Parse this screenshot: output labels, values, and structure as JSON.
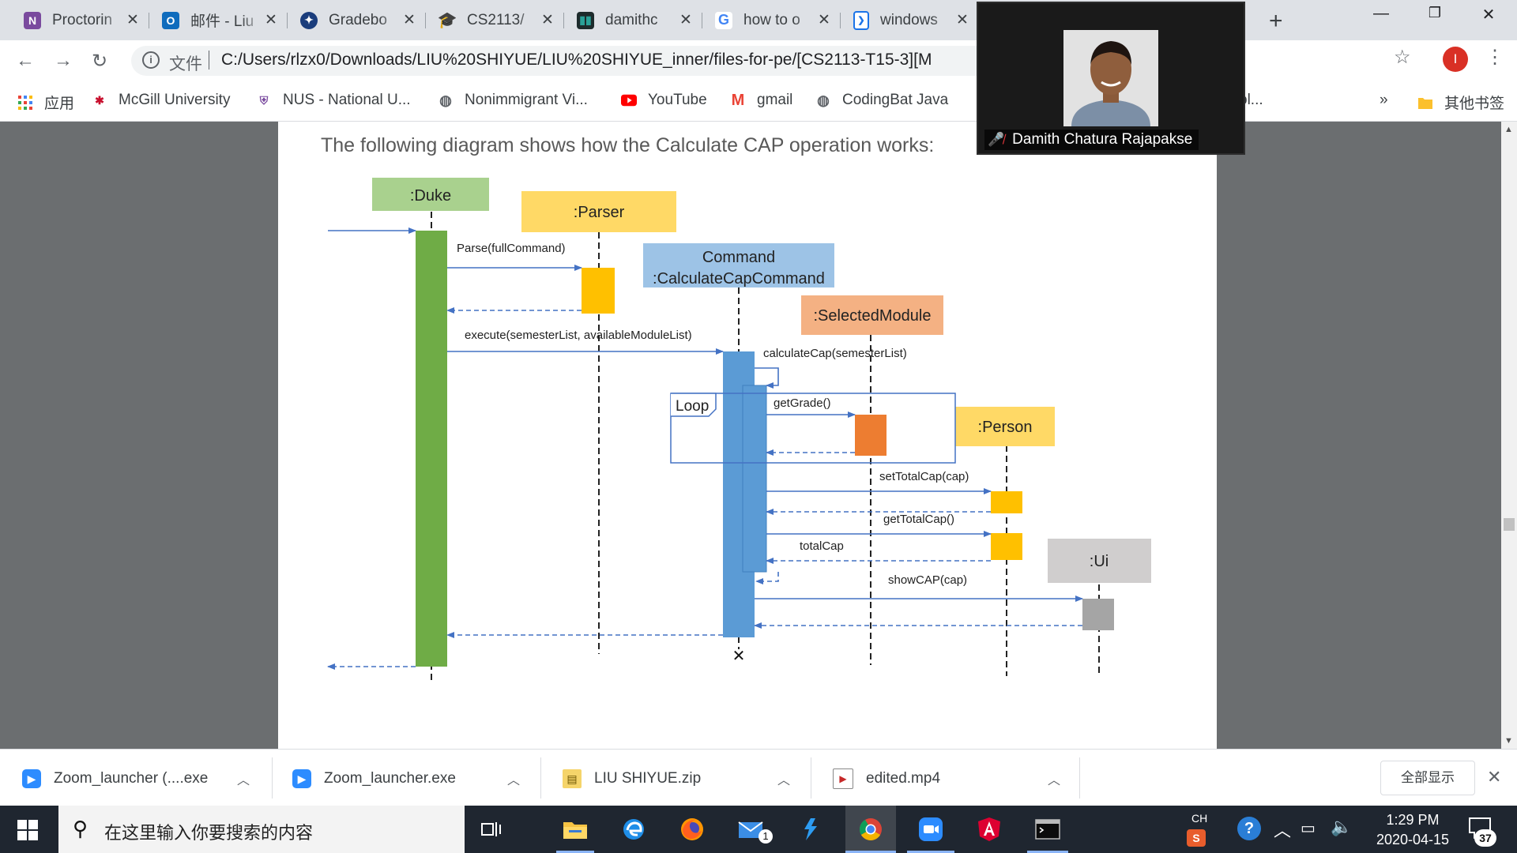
{
  "browser": {
    "tabs": [
      {
        "title": "Proctorin",
        "icon": "nus-crest-icon",
        "color": "#7a4a9e"
      },
      {
        "title": "邮件 - Liu",
        "icon": "outlook-icon",
        "color": "#0f6cbd"
      },
      {
        "title": "Gradebo",
        "icon": "gradebook-icon",
        "color": "#1a3d7c"
      },
      {
        "title": "CS2113/",
        "icon": "graduation-cap-icon",
        "color": "#2d63c8"
      },
      {
        "title": "damithc",
        "icon": "netlify-icon",
        "color": "#2aa198"
      },
      {
        "title": "how to o",
        "icon": "google-icon",
        "color": "#4285f4"
      },
      {
        "title": "windows",
        "icon": "docs-icon",
        "color": "#1a73e8"
      }
    ],
    "address": {
      "scheme_label": "文件",
      "url": "C:/Users/rlzx0/Downloads/LIU%20SHIYUE/LIU%20SHIYUE_inner/files-for-pe/[CS2113-T15-3][M"
    },
    "profile_initial": "I",
    "bookmarks": [
      {
        "label": "应用",
        "icon": "apps-grid-icon"
      },
      {
        "label": "McGill University",
        "icon": "mcgill-icon"
      },
      {
        "label": "NUS - National U...",
        "icon": "nus-crest-icon"
      },
      {
        "label": "Nonimmigrant Vi...",
        "icon": "globe-icon"
      },
      {
        "label": "YouTube",
        "icon": "youtube-icon"
      },
      {
        "label": "gmail",
        "icon": "gmail-icon"
      },
      {
        "label": "CodingBat Java",
        "icon": "globe-icon"
      },
      {
        "label": "ol...",
        "icon": "folder-icon"
      }
    ],
    "bookmarks_overflow": "»",
    "other_bookmarks": "其他书签"
  },
  "zoom": {
    "participant_name": "Damith Chatura Rajapakse"
  },
  "document": {
    "caption": "The following diagram shows how the Calculate CAP operation works:"
  },
  "diagram": {
    "lifelines": {
      "duke": ":Duke",
      "parser": ":Parser",
      "command_line1": "Command",
      "command_line2": ":CalculateCapCommand",
      "selected": ":SelectedModule",
      "person": ":Person",
      "ui": ":Ui"
    },
    "messages": {
      "parse": "Parse(fullCommand)",
      "execute": "execute(semesterList, availableModuleList)",
      "calculate": "calculateCap(semesterList)",
      "getgrade": "getGrade()",
      "settotal": "setTotalCap(cap)",
      "gettotal": "getTotalCap()",
      "totalcap": "totalCap",
      "showcap": "showCAP(cap)"
    },
    "fragment": "Loop",
    "destroy_mark": "✕",
    "colors": {
      "duke": "#6fac46",
      "duke_header": "#a9d18e",
      "parser": "#ffc000",
      "parser_header": "#ffd966",
      "command": "#5b9bd5",
      "command_header": "#9dc3e6",
      "selected": "#ed7d31",
      "selected_header": "#f4b183",
      "person": "#ffc000",
      "person_header": "#ffd966",
      "ui": "#a5a5a5",
      "ui_header": "#d0cece",
      "arrow": "#4472c4"
    }
  },
  "downloads": {
    "items": [
      {
        "name": "Zoom_launcher (....exe",
        "icon": "zoom-icon"
      },
      {
        "name": "Zoom_launcher.exe",
        "icon": "zoom-icon"
      },
      {
        "name": "LIU SHIYUE.zip",
        "icon": "zip-icon"
      },
      {
        "name": "edited.mp4",
        "icon": "video-file-icon"
      }
    ],
    "show_all": "全部显示"
  },
  "taskbar": {
    "search_placeholder": "在这里输入你要搜索的内容",
    "ime": "CH",
    "mail_badge": "1",
    "clock_time": "1:29 PM",
    "clock_date": "2020-04-15",
    "notification_count": "37"
  }
}
